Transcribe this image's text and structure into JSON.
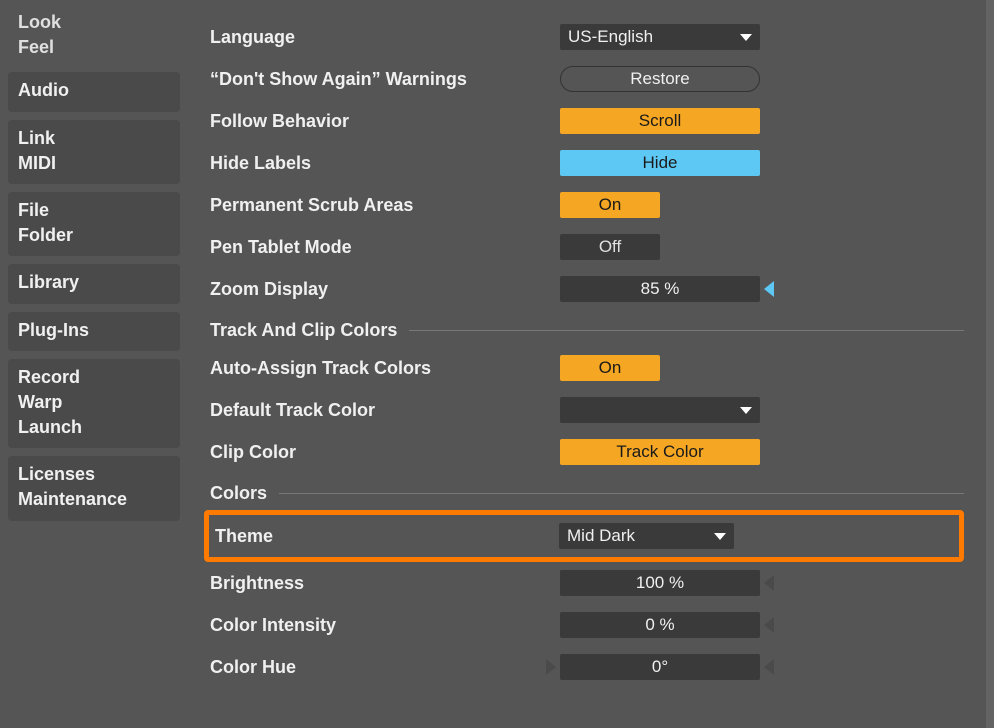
{
  "sidebar": {
    "groups": [
      [
        "Look",
        "Feel"
      ],
      [
        "Audio"
      ],
      [
        "Link",
        "MIDI"
      ],
      [
        "File",
        "Folder"
      ],
      [
        "Library"
      ],
      [
        "Plug-Ins"
      ],
      [
        "Record",
        "Warp",
        "Launch"
      ],
      [
        "Licenses",
        "Maintenance"
      ]
    ]
  },
  "settings": {
    "language": {
      "label": "Language",
      "value": "US-English"
    },
    "warnings": {
      "label": "“Don't Show Again” Warnings",
      "button": "Restore"
    },
    "follow": {
      "label": "Follow Behavior",
      "value": "Scroll"
    },
    "hideLabels": {
      "label": "Hide Labels",
      "value": "Hide"
    },
    "scrub": {
      "label": "Permanent Scrub Areas",
      "value": "On"
    },
    "pen": {
      "label": "Pen Tablet Mode",
      "value": "Off"
    },
    "zoom": {
      "label": "Zoom Display",
      "value": "85 %"
    }
  },
  "sections": {
    "trackClip": "Track And Clip Colors",
    "colors": "Colors"
  },
  "trackClip": {
    "autoAssign": {
      "label": "Auto-Assign Track Colors",
      "value": "On"
    },
    "defaultTrack": {
      "label": "Default Track Color"
    },
    "clipColor": {
      "label": "Clip Color",
      "value": "Track Color"
    }
  },
  "colors": {
    "theme": {
      "label": "Theme",
      "value": "Mid Dark"
    },
    "brightness": {
      "label": "Brightness",
      "value": "100 %"
    },
    "intensity": {
      "label": "Color Intensity",
      "value": "0 %"
    },
    "hue": {
      "label": "Color Hue",
      "value": "0°"
    }
  }
}
